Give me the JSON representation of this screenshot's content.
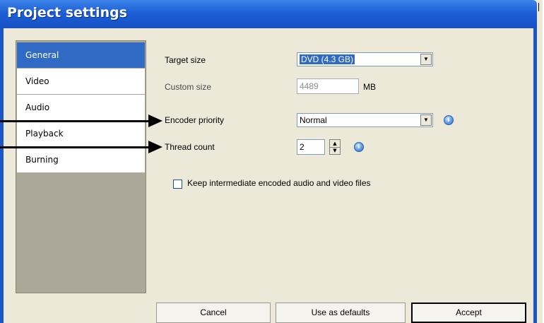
{
  "window": {
    "title": "Project settings"
  },
  "sidebar": {
    "items": [
      {
        "label": "General",
        "selected": true
      },
      {
        "label": "Video",
        "selected": false
      },
      {
        "label": "Audio",
        "selected": false
      },
      {
        "label": "Playback",
        "selected": false
      },
      {
        "label": "Burning",
        "selected": false
      }
    ]
  },
  "general": {
    "target_size": {
      "label": "Target size",
      "value": "DVD (4.3 GB)"
    },
    "custom_size": {
      "label": "Custom size",
      "value": "4489",
      "unit": "MB",
      "enabled": false
    },
    "encoder_priority": {
      "label": "Encoder priority",
      "value": "Normal"
    },
    "thread_count": {
      "label": "Thread count",
      "value": "2"
    },
    "keep_files": {
      "label": "Keep intermediate encoded audio and video files",
      "checked": false
    }
  },
  "buttons": {
    "cancel": "Cancel",
    "use_as_defaults": "Use as defaults",
    "accept": "Accept"
  },
  "colors": {
    "titlebar": "#1d5fd6",
    "selection": "#316ac5",
    "dialog_bg": "#ece9d8",
    "sidebar_bg": "#aca899"
  },
  "icons": [
    "info-icon",
    "dropdown-arrow-icon",
    "spin-up-icon",
    "spin-down-icon",
    "callout-arrow"
  ]
}
